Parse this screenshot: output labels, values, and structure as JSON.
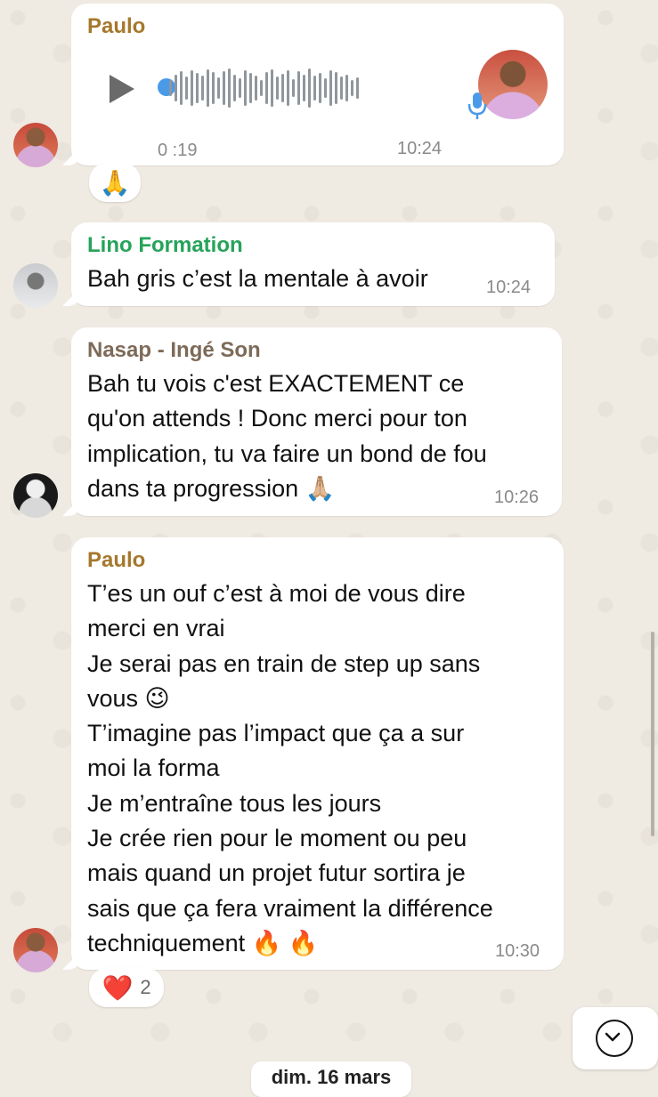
{
  "messages": [
    {
      "sender": "Paulo",
      "type": "voice",
      "duration": "0 :19",
      "time": "10:24",
      "reaction": "🙏"
    },
    {
      "sender": "Lino Formation",
      "text": "Bah gris c’est la mentale à avoir",
      "time": "10:24"
    },
    {
      "sender": "Nasap - Ingé Son",
      "text": "Bah tu vois c'est EXACTEMENT ce\nqu'on attends ! Donc merci pour ton\nimplication, tu va faire un bond de fou\ndans ta progression 🙏🏼",
      "time": "10:26"
    },
    {
      "sender": "Paulo",
      "text": "T’es un ouf c’est à moi de vous dire\nmerci en vrai\nJe serai pas en train de step up sans\nvous 😉\nT’imagine pas l’impact que ça a sur\nmoi la forma\nJe m’entraîne tous les jours\nJe crée rien pour le moment ou peu\nmais quand un projet futur sortira je\nsais que ça fera vraiment la différence\ntechniquement 🔥 🔥",
      "time": "10:30",
      "reaction": {
        "emoji": "❤️",
        "count": "2"
      }
    }
  ],
  "date_separator": "dim. 16 mars",
  "icons": {
    "play": "play-icon",
    "mic": "microphone-icon",
    "scroll": "chevron-down-icon"
  },
  "colors": {
    "background": "#efeae2",
    "bubble": "#ffffff",
    "sender_paulo": "#a5782c",
    "sender_lino": "#25a35a",
    "sender_nasap": "#7d6a58",
    "voice_accent": "#4a9ae8"
  }
}
